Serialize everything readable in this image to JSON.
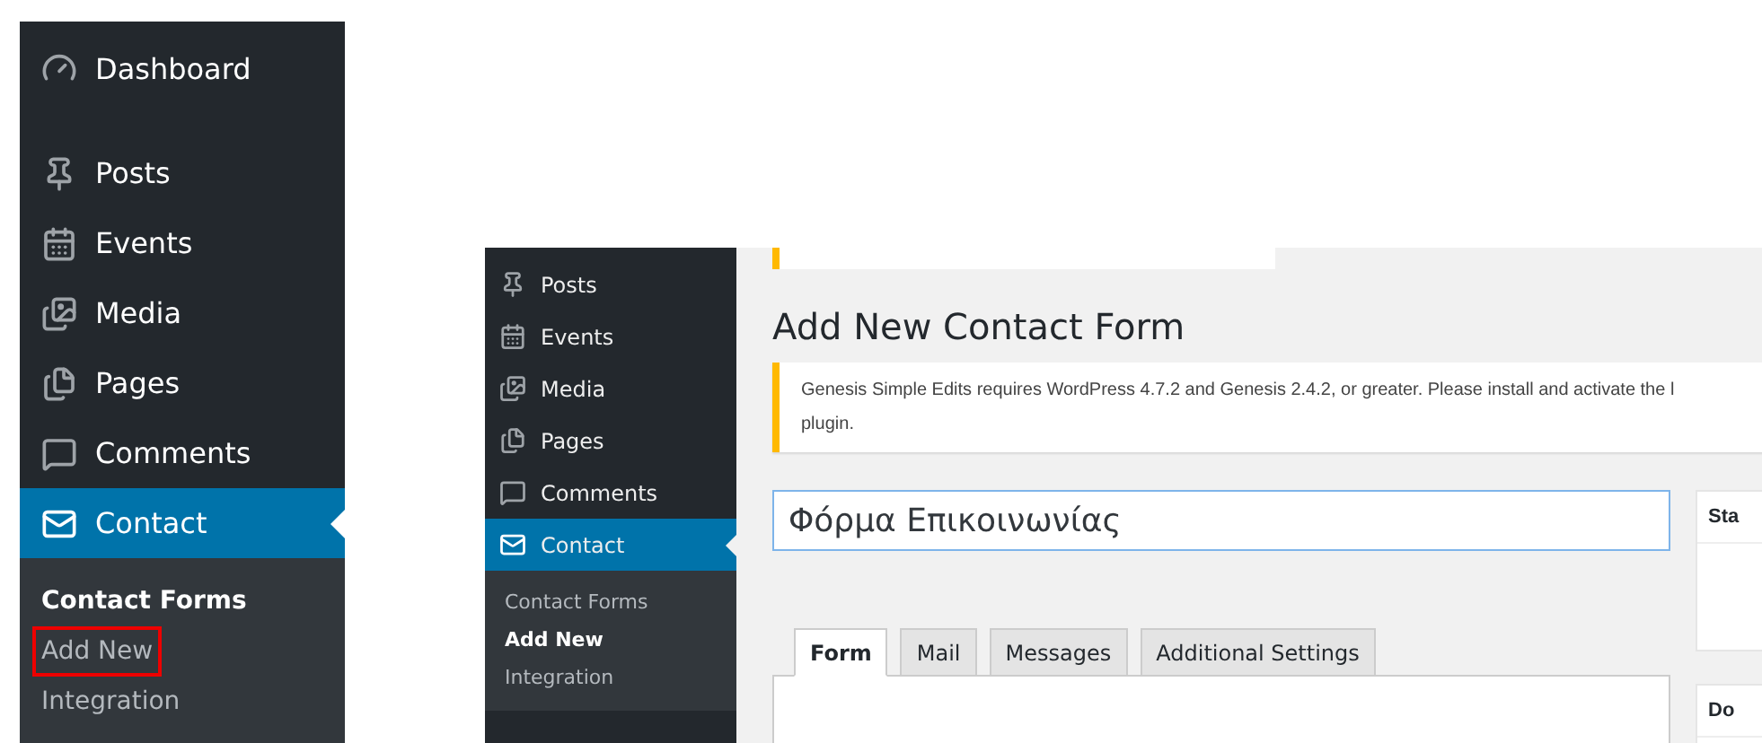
{
  "large_menu": {
    "items": [
      {
        "label": "Dashboard",
        "selected": false
      },
      {
        "label": "Posts",
        "selected": false
      },
      {
        "label": "Events",
        "selected": false
      },
      {
        "label": "Media",
        "selected": false
      },
      {
        "label": "Pages",
        "selected": false
      },
      {
        "label": "Comments",
        "selected": false
      },
      {
        "label": "Contact",
        "selected": true
      }
    ],
    "submenu": [
      {
        "label": "Contact Forms",
        "selected": true,
        "highlighted": false
      },
      {
        "label": "Add New",
        "selected": false,
        "highlighted": true
      },
      {
        "label": "Integration",
        "selected": false,
        "highlighted": false
      }
    ]
  },
  "screenshot": {
    "menu": {
      "items": [
        {
          "label": "Posts",
          "selected": false
        },
        {
          "label": "Events",
          "selected": false
        },
        {
          "label": "Media",
          "selected": false
        },
        {
          "label": "Pages",
          "selected": false
        },
        {
          "label": "Comments",
          "selected": false
        },
        {
          "label": "Contact",
          "selected": true
        }
      ],
      "submenu": [
        {
          "label": "Contact Forms",
          "selected": false
        },
        {
          "label": "Add New",
          "selected": true
        },
        {
          "label": "Integration",
          "selected": false
        }
      ]
    },
    "page_title": "Add New Contact Form",
    "notice": {
      "lines": [
        "Genesis Simple Edits requires WordPress 4.7.2 and Genesis 2.4.2, or greater. Please install and activate the l",
        "plugin."
      ]
    },
    "title_field": {
      "value": "Φόρμα Επικοινωνίας"
    },
    "tabs": [
      {
        "label": "Form",
        "selected": true
      },
      {
        "label": "Mail",
        "selected": false
      },
      {
        "label": "Messages",
        "selected": false
      },
      {
        "label": "Additional Settings",
        "selected": false
      }
    ],
    "side_boxes": [
      {
        "title": "Sta"
      },
      {
        "title": "Do"
      }
    ]
  }
}
